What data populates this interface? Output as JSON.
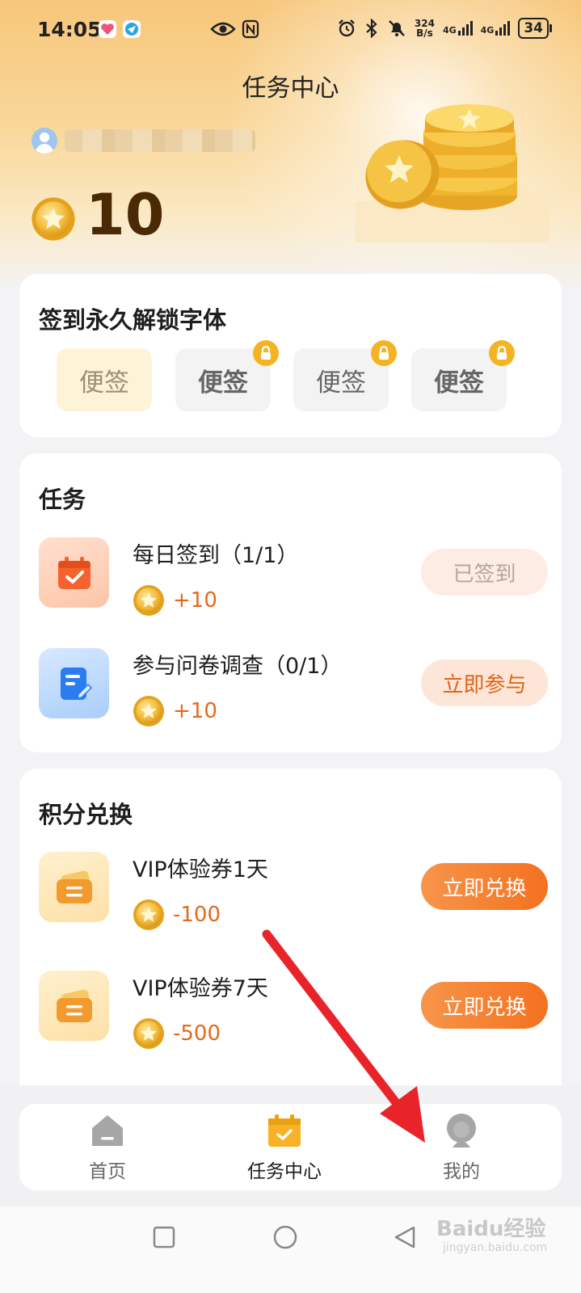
{
  "status_bar": {
    "time": "14:05",
    "net_speed_top": "324",
    "net_speed_bottom": "B/s",
    "signal1": "4G",
    "signal2": "4G",
    "battery": "34"
  },
  "header": {
    "title": "任务中心",
    "points": "10"
  },
  "fonts_card": {
    "title": "签到永久解锁字体",
    "tiles": [
      {
        "label": "便签",
        "locked": false
      },
      {
        "label": "便签",
        "locked": true
      },
      {
        "label": "便签",
        "locked": true
      },
      {
        "label": "便签",
        "locked": true
      }
    ]
  },
  "tasks_card": {
    "title": "任务",
    "items": [
      {
        "name": "每日签到（1/1）",
        "reward": "+10",
        "button": "已签到",
        "icon": "calendar-check-icon"
      },
      {
        "name": "参与问卷调查（0/1）",
        "reward": "+10",
        "button": "立即参与",
        "icon": "survey-document-icon"
      }
    ]
  },
  "exchange_card": {
    "title": "积分兑换",
    "items": [
      {
        "name": "VIP体验券1天",
        "cost": "-100",
        "button": "立即兑换",
        "icon": "ticket-icon"
      },
      {
        "name": "VIP体验券7天",
        "cost": "-500",
        "button": "立即兑换",
        "icon": "ticket-icon"
      }
    ]
  },
  "tabbar": {
    "items": [
      {
        "label": "首页",
        "icon": "home-icon",
        "active": false
      },
      {
        "label": "任务中心",
        "icon": "calendar-check-icon",
        "active": true
      },
      {
        "label": "我的",
        "icon": "profile-icon",
        "active": false
      }
    ]
  },
  "watermark": {
    "text": "Baidu经验",
    "url": "jingyan.baidu.com"
  },
  "colors": {
    "accent_orange": "#f4711f",
    "coin_gold": "#f0b52e",
    "header_top": "#f7c77b",
    "annotation_arrow": "#e8242a"
  }
}
